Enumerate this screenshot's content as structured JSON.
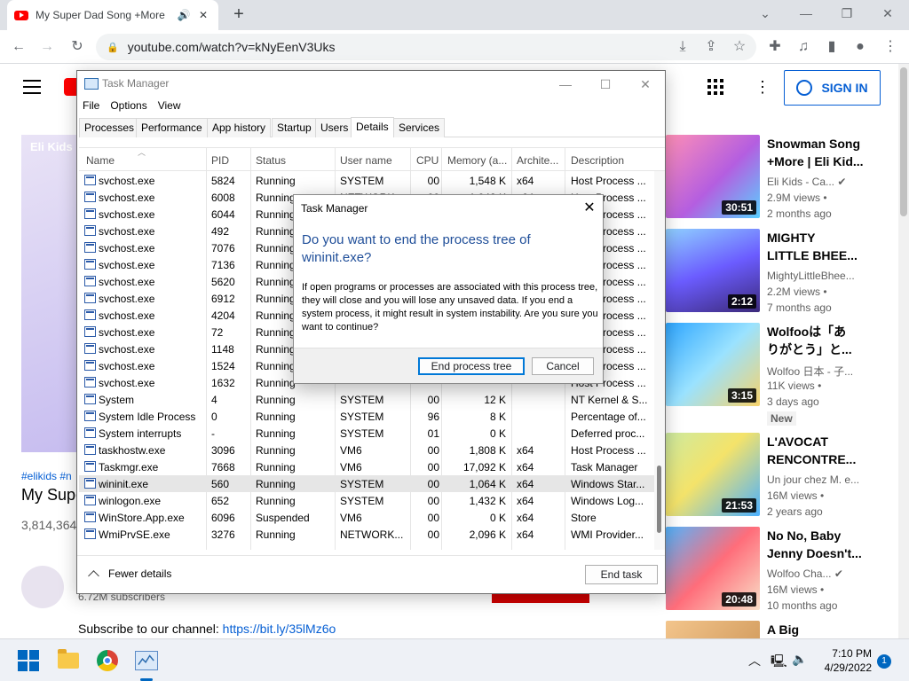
{
  "browser": {
    "tab_title": "My Super Dad Song +More",
    "url": "youtube.com/watch?v=kNyEenV3Uks"
  },
  "youtube": {
    "signin_label": "SIGN IN",
    "video_frame_text": "Eli Kids",
    "hashtags": "#elikids #n",
    "video_title": "My Supe",
    "views": "3,814,364",
    "subscribers": "6.72M subscribers",
    "description_prefix": "Subscribe to our channel: ",
    "description_link": "https://bit.ly/35lMz6o",
    "recommendations": [
      {
        "title": "Snowman Song\n+More | Eli Kid...",
        "channel": "Eli Kids - Ca...",
        "verified": true,
        "views": "2.9M views •",
        "age": "2 months ago",
        "duration": "30:51",
        "badge": ""
      },
      {
        "title": "MIGHTY\nLITTLE BHEE...",
        "channel": "MightyLittleBhee...",
        "verified": false,
        "views": "2.2M views •",
        "age": "7 months ago",
        "duration": "2:12",
        "badge": ""
      },
      {
        "title": "Wolfooは「あ\nりがとう」と...",
        "channel": "Wolfoo 日本 - 子...",
        "verified": false,
        "views": "11K views •",
        "age": "3 days ago",
        "duration": "3:15",
        "badge": "New"
      },
      {
        "title": "L'AVOCAT\nRENCONTRE...",
        "channel": "Un jour chez M. e...",
        "verified": false,
        "views": "16M views •",
        "age": "2 years ago",
        "duration": "21:53",
        "badge": ""
      },
      {
        "title": "No No, Baby\nJenny Doesn't...",
        "channel": "Wolfoo Cha...",
        "verified": true,
        "views": "16M views •",
        "age": "10 months ago",
        "duration": "20:48",
        "badge": ""
      },
      {
        "title": "A Big",
        "channel": "",
        "verified": false,
        "views": "",
        "age": "",
        "duration": "",
        "badge": ""
      }
    ]
  },
  "task_manager": {
    "title": "Task Manager",
    "menu": [
      "File",
      "Options",
      "View"
    ],
    "tabs": [
      "Processes",
      "Performance",
      "App history",
      "Startup",
      "Users",
      "Details",
      "Services"
    ],
    "active_tab": "Details",
    "columns": [
      "Name",
      "PID",
      "Status",
      "User name",
      "CPU",
      "Memory (a...",
      "Archite...",
      "Description"
    ],
    "rows": [
      {
        "name": "svchost.exe",
        "pid": "5824",
        "status": "Running",
        "user": "SYSTEM",
        "cpu": "00",
        "mem": "1,548 K",
        "arch": "x64",
        "desc": "Host Process ..."
      },
      {
        "name": "svchost.exe",
        "pid": "6008",
        "status": "Running",
        "user": "NETWORK...",
        "cpu": "00",
        "mem": "1,048 K",
        "arch": "x64",
        "desc": "Host Process ..."
      },
      {
        "name": "svchost.exe",
        "pid": "6044",
        "status": "Running",
        "user": "",
        "cpu": "",
        "mem": "",
        "arch": "",
        "desc": "Host Process ..."
      },
      {
        "name": "svchost.exe",
        "pid": "492",
        "status": "Running",
        "user": "",
        "cpu": "",
        "mem": "",
        "arch": "",
        "desc": "Host Process ..."
      },
      {
        "name": "svchost.exe",
        "pid": "7076",
        "status": "Running",
        "user": "",
        "cpu": "",
        "mem": "",
        "arch": "",
        "desc": "Host Process ..."
      },
      {
        "name": "svchost.exe",
        "pid": "7136",
        "status": "Running",
        "user": "",
        "cpu": "",
        "mem": "",
        "arch": "",
        "desc": "Host Process ..."
      },
      {
        "name": "svchost.exe",
        "pid": "5620",
        "status": "Running",
        "user": "",
        "cpu": "",
        "mem": "",
        "arch": "",
        "desc": "Host Process ..."
      },
      {
        "name": "svchost.exe",
        "pid": "6912",
        "status": "Running",
        "user": "",
        "cpu": "",
        "mem": "",
        "arch": "",
        "desc": "Host Process ..."
      },
      {
        "name": "svchost.exe",
        "pid": "4204",
        "status": "Running",
        "user": "",
        "cpu": "",
        "mem": "",
        "arch": "",
        "desc": "Host Process ..."
      },
      {
        "name": "svchost.exe",
        "pid": "72",
        "status": "Running",
        "user": "",
        "cpu": "",
        "mem": "",
        "arch": "",
        "desc": "Host Process ..."
      },
      {
        "name": "svchost.exe",
        "pid": "1148",
        "status": "Running",
        "user": "",
        "cpu": "",
        "mem": "",
        "arch": "",
        "desc": "Host Process ..."
      },
      {
        "name": "svchost.exe",
        "pid": "1524",
        "status": "Running",
        "user": "",
        "cpu": "",
        "mem": "",
        "arch": "",
        "desc": "Host Process ..."
      },
      {
        "name": "svchost.exe",
        "pid": "1632",
        "status": "Running",
        "user": "",
        "cpu": "",
        "mem": "",
        "arch": "",
        "desc": "Host Process ..."
      },
      {
        "name": "System",
        "pid": "4",
        "status": "Running",
        "user": "SYSTEM",
        "cpu": "00",
        "mem": "12 K",
        "arch": "",
        "desc": "NT Kernel & S..."
      },
      {
        "name": "System Idle Process",
        "pid": "0",
        "status": "Running",
        "user": "SYSTEM",
        "cpu": "96",
        "mem": "8 K",
        "arch": "",
        "desc": "Percentage of..."
      },
      {
        "name": "System interrupts",
        "pid": "-",
        "status": "Running",
        "user": "SYSTEM",
        "cpu": "01",
        "mem": "0 K",
        "arch": "",
        "desc": "Deferred proc..."
      },
      {
        "name": "taskhostw.exe",
        "pid": "3096",
        "status": "Running",
        "user": "VM6",
        "cpu": "00",
        "mem": "1,808 K",
        "arch": "x64",
        "desc": "Host Process ..."
      },
      {
        "name": "Taskmgr.exe",
        "pid": "7668",
        "status": "Running",
        "user": "VM6",
        "cpu": "00",
        "mem": "17,092 K",
        "arch": "x64",
        "desc": "Task Manager"
      },
      {
        "name": "wininit.exe",
        "pid": "560",
        "status": "Running",
        "user": "SYSTEM",
        "cpu": "00",
        "mem": "1,064 K",
        "arch": "x64",
        "desc": "Windows Star...",
        "selected": true
      },
      {
        "name": "winlogon.exe",
        "pid": "652",
        "status": "Running",
        "user": "SYSTEM",
        "cpu": "00",
        "mem": "1,432 K",
        "arch": "x64",
        "desc": "Windows Log..."
      },
      {
        "name": "WinStore.App.exe",
        "pid": "6096",
        "status": "Suspended",
        "user": "VM6",
        "cpu": "00",
        "mem": "0 K",
        "arch": "x64",
        "desc": "Store"
      },
      {
        "name": "WmiPrvSE.exe",
        "pid": "3276",
        "status": "Running",
        "user": "NETWORK...",
        "cpu": "00",
        "mem": "2,096 K",
        "arch": "x64",
        "desc": "WMI Provider..."
      }
    ],
    "fewer_details": "Fewer details",
    "end_task": "End task"
  },
  "dialog": {
    "title": "Task Manager",
    "heading": "Do you want to end the process tree of wininit.exe?",
    "body": "If open programs or processes are associated with this process tree, they will close and you will lose any unsaved data. If you end a system process, it might result in system instability. Are you sure you want to continue?",
    "primary_button": "End process tree",
    "cancel_button": "Cancel"
  },
  "taskbar": {
    "time": "7:10 PM",
    "date": "4/29/2022",
    "notification_count": "1"
  },
  "colors": {
    "accent": "#0067c0",
    "youtube_red": "#ff0000",
    "link_blue": "#065fd4",
    "dialog_heading": "#1f4e99"
  }
}
